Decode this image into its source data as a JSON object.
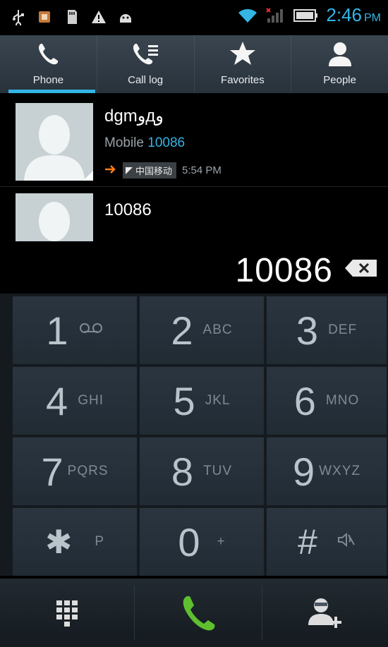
{
  "status_bar": {
    "time": "2:46",
    "ampm": "PM",
    "icons_left": [
      "usb-icon",
      "sim-toolkit-icon",
      "sd-card-icon",
      "warning-icon",
      "android-icon"
    ],
    "icons_right": [
      "wifi-icon",
      "signal-icon",
      "battery-icon"
    ]
  },
  "tabs": [
    {
      "label": "Phone",
      "icon": "phone-icon",
      "selected": true
    },
    {
      "label": "Call log",
      "icon": "call-log-icon",
      "selected": false
    },
    {
      "label": "Favorites",
      "icon": "star-icon",
      "selected": false
    },
    {
      "label": "People",
      "icon": "person-icon",
      "selected": false
    }
  ],
  "results": [
    {
      "name": "dgmوдو",
      "type": "Mobile",
      "number": "10086",
      "carrier": "中国移动",
      "time": "5:54 PM"
    },
    {
      "name": "10086"
    }
  ],
  "dialer": {
    "entered": "10086"
  },
  "keys": [
    {
      "digit": "1",
      "letters": ""
    },
    {
      "digit": "2",
      "letters": "ABC"
    },
    {
      "digit": "3",
      "letters": "DEF"
    },
    {
      "digit": "4",
      "letters": "GHI"
    },
    {
      "digit": "5",
      "letters": "JKL"
    },
    {
      "digit": "6",
      "letters": "MNO"
    },
    {
      "digit": "7",
      "letters": "PQRS"
    },
    {
      "digit": "8",
      "letters": "TUV"
    },
    {
      "digit": "9",
      "letters": "WXYZ"
    },
    {
      "digit": "✱",
      "letters": "P"
    },
    {
      "digit": "0",
      "letters": "+"
    },
    {
      "digit": "#",
      "letters": ""
    }
  ],
  "colors": {
    "accent": "#33b5e5",
    "call_green": "#5fbf2f"
  }
}
